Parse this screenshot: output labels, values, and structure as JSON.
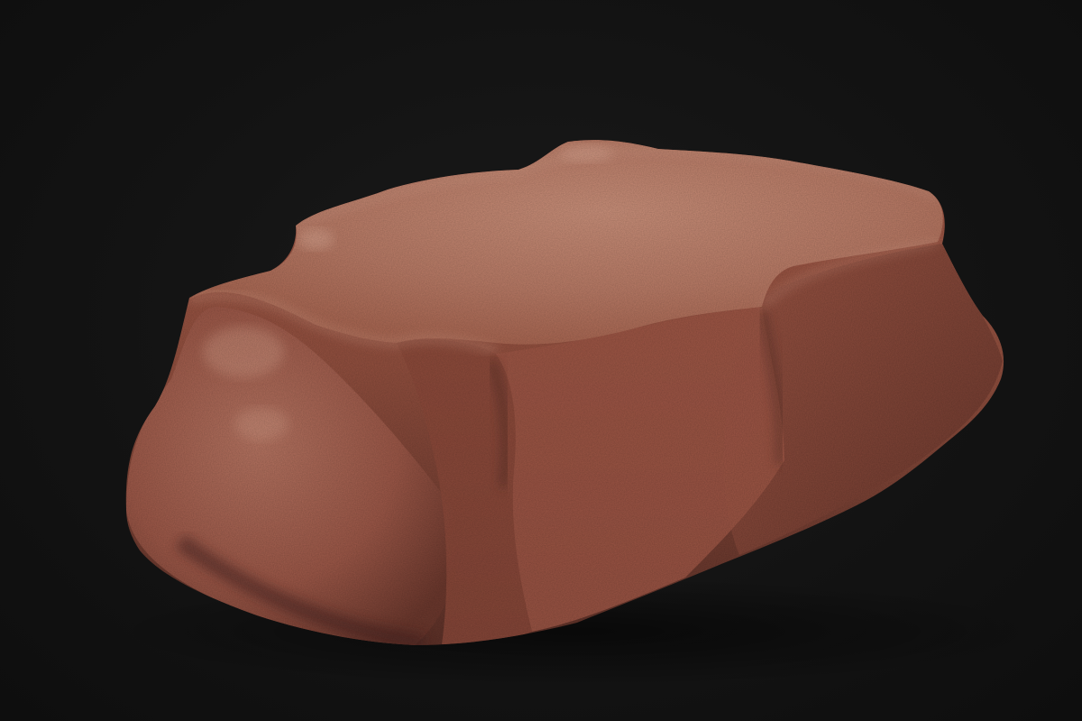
{
  "scene": {
    "subject": "rock-3d-render",
    "background_color": "#121212",
    "rock_colors": {
      "top_light": "#c98c76",
      "top_mid": "#b87764",
      "side": "#9a5444",
      "side_dark": "#6e3a2f",
      "shadow": "#4a2620",
      "highlight": "#e4b3a0"
    }
  }
}
